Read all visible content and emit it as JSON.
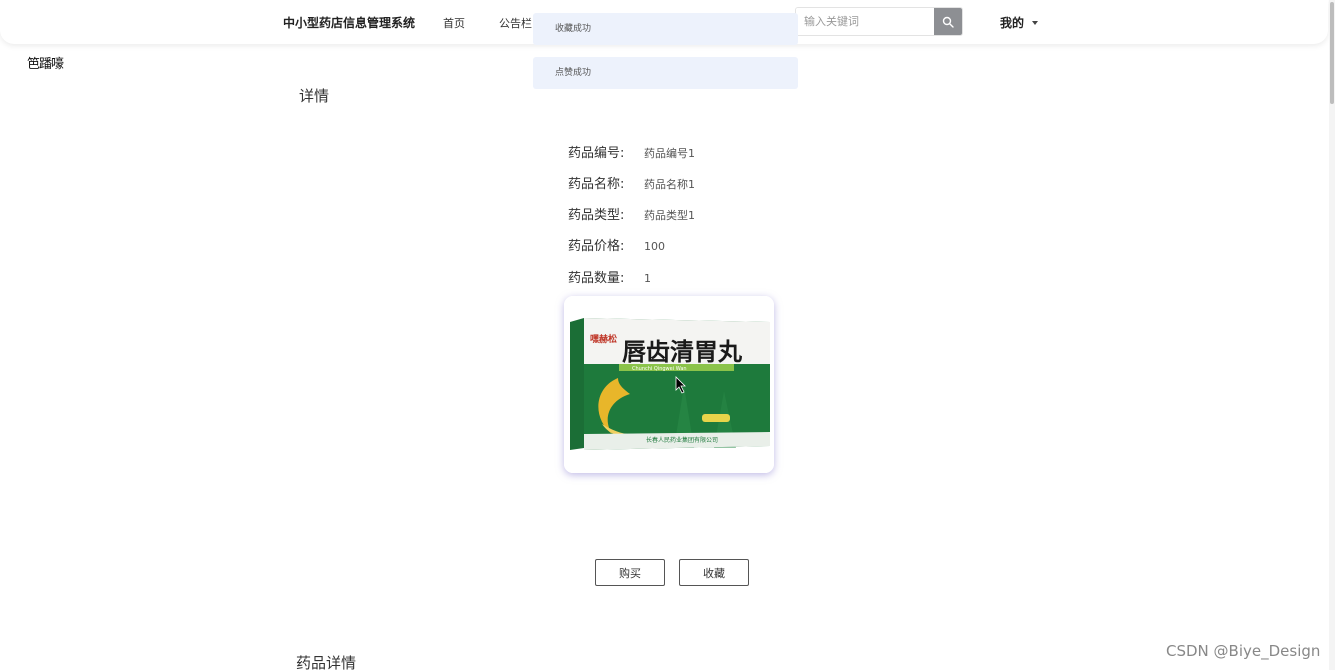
{
  "navbar": {
    "brand": "中小型药店信息管理系统",
    "links": [
      "首页",
      "公告栏"
    ],
    "search_placeholder": "输入关键词",
    "mine_label": "我的"
  },
  "toasts": [
    "收藏成功",
    "点赞成功"
  ],
  "stray_text": "笆蹯嚎",
  "detail": {
    "title": "详情",
    "fields": [
      {
        "label": "药品编号:",
        "value": "药品编号1"
      },
      {
        "label": "药品名称:",
        "value": "药品名称1"
      },
      {
        "label": "药品类型:",
        "value": "药品类型1"
      },
      {
        "label": "药品价格:",
        "value": "100"
      },
      {
        "label": "药品数量:",
        "value": "1"
      }
    ],
    "product_image": {
      "brand_mark": "嘿赫松",
      "product_name": "唇齿清胃丸",
      "english_name": "Chunchi Qingwei Wan",
      "maker": "长春人民药业集团有限公司"
    }
  },
  "actions": {
    "buy": "购买",
    "favorite": "收藏"
  },
  "drug_detail_title": "药品详情",
  "watermark": "CSDN @Biye_Design",
  "colors": {
    "toast_bg": "#edf2fc",
    "search_button": "#8d8f93",
    "box_green": "#1e7a3c"
  }
}
